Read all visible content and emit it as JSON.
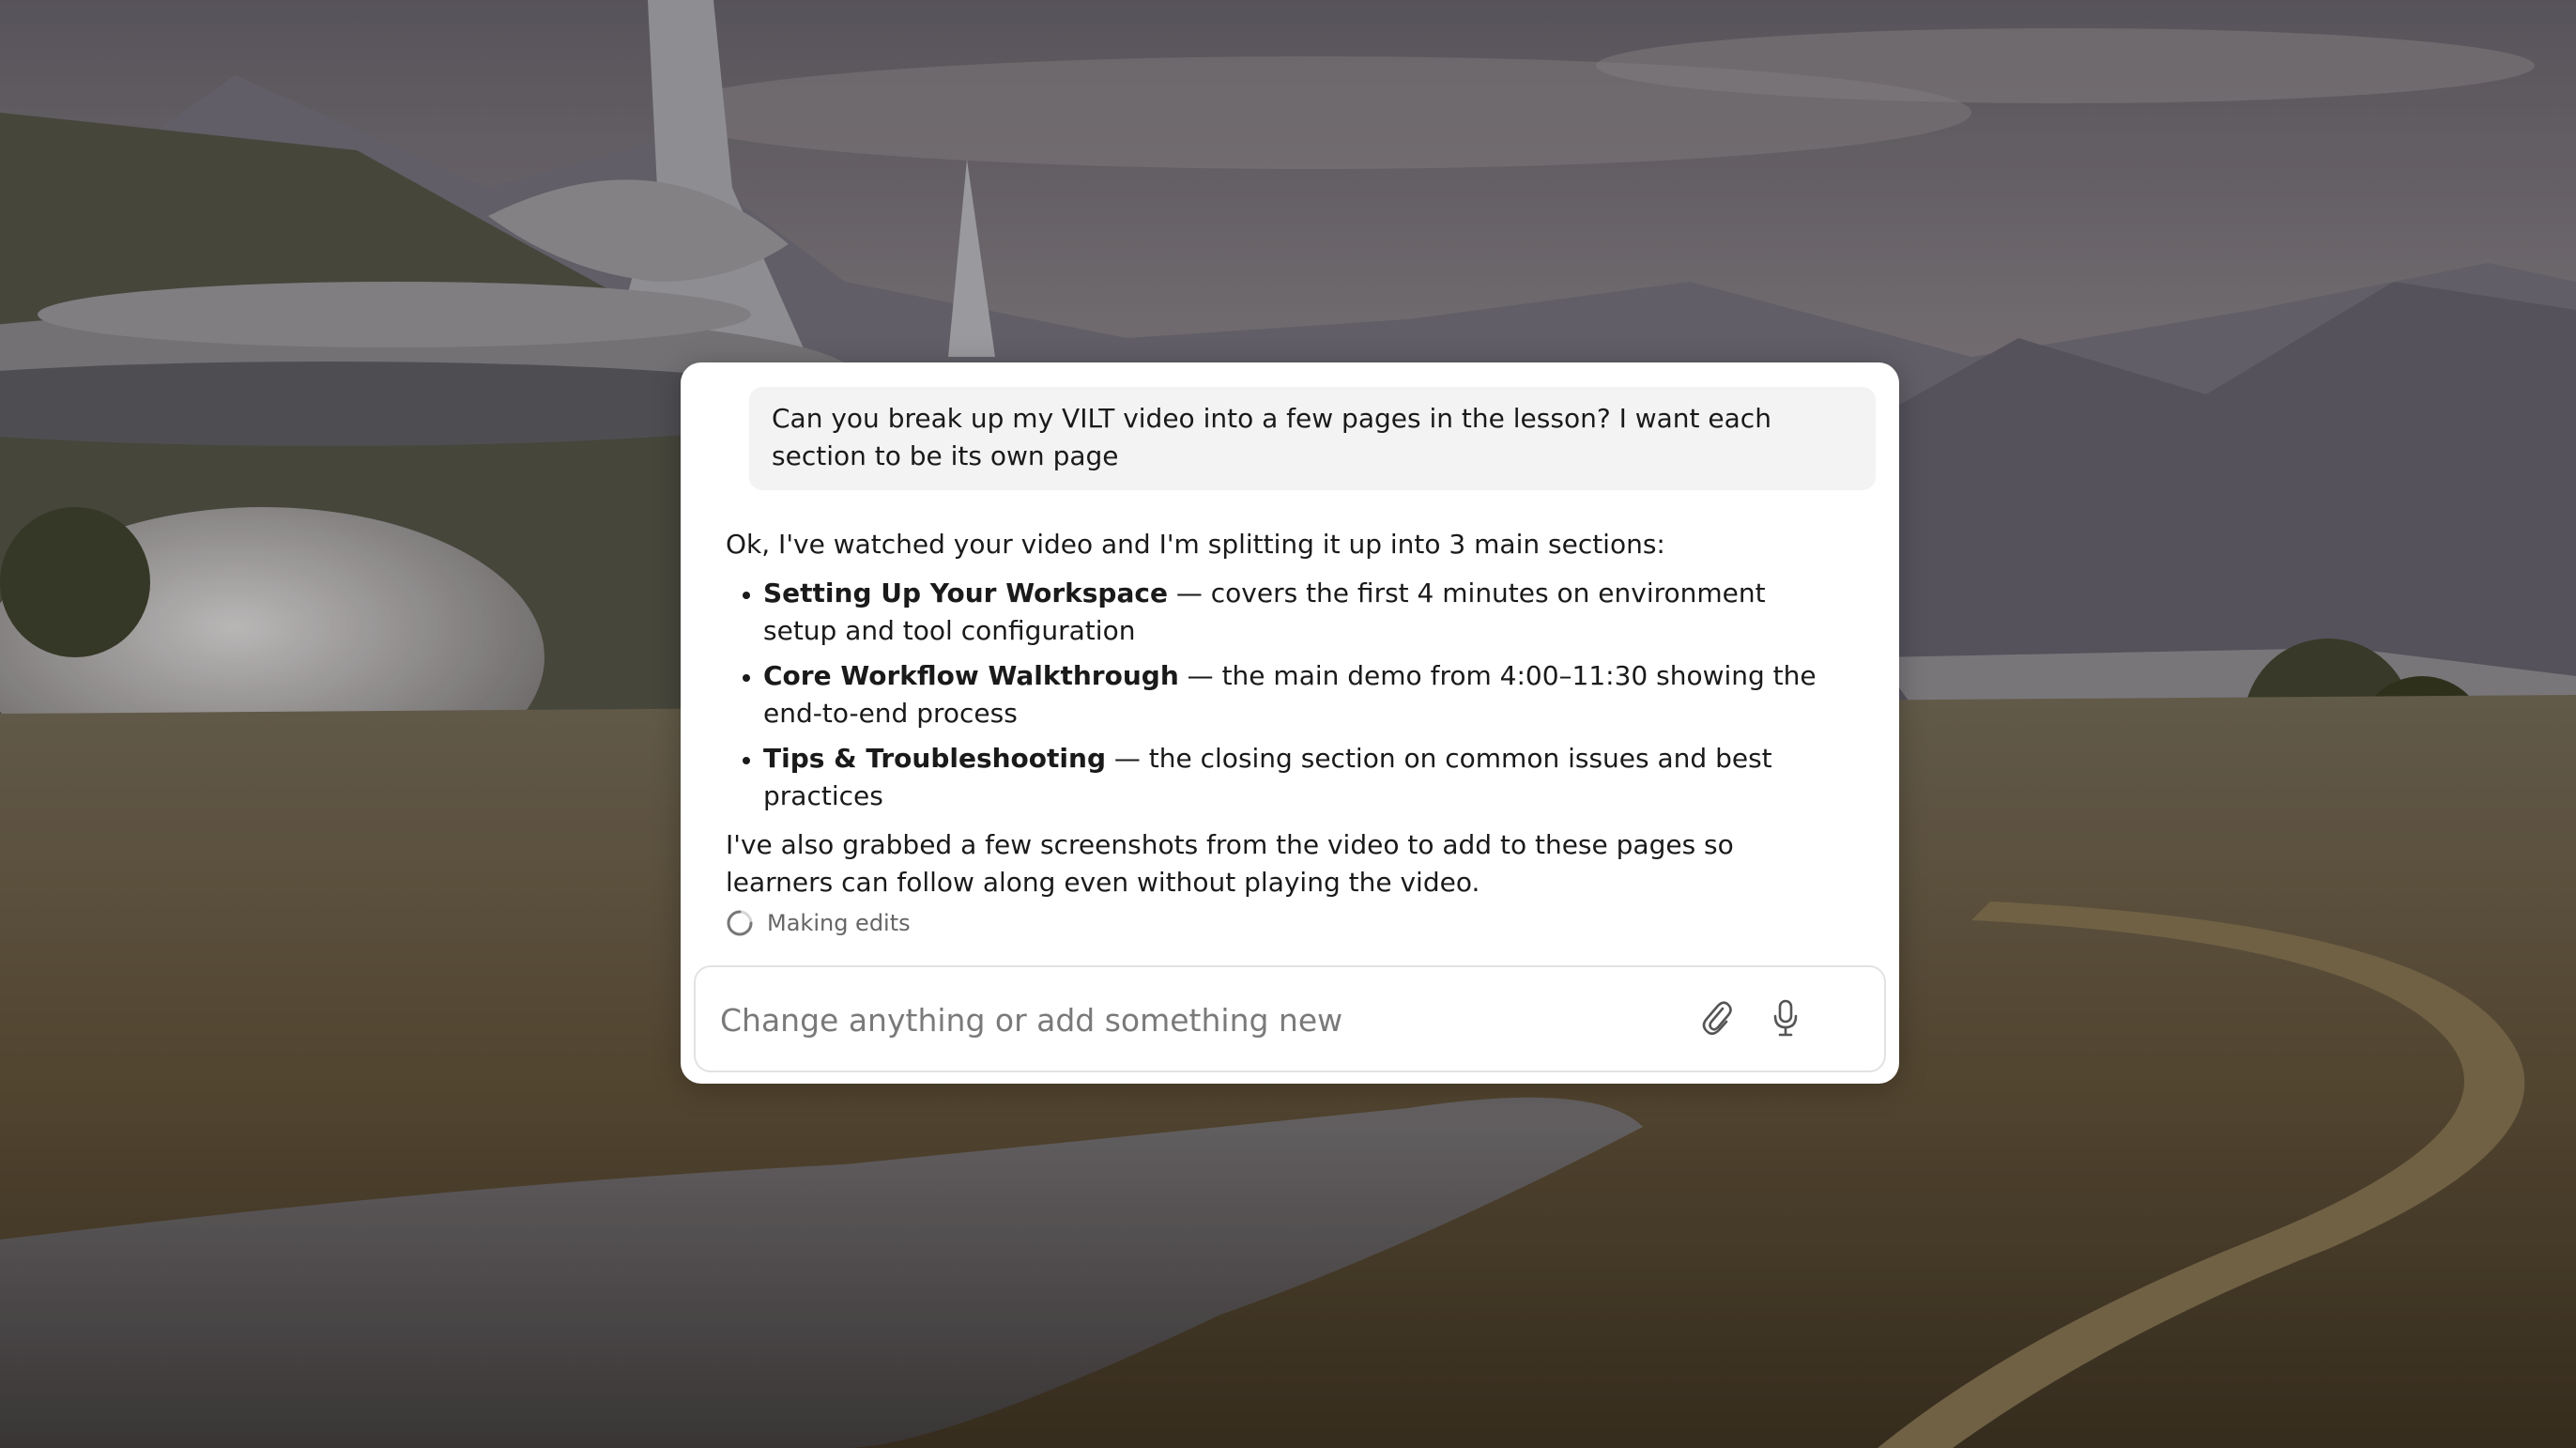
{
  "chat": {
    "user_message": "Can you break up my VILT video into a few pages in the lesson? I want each section to be its own page",
    "assistant": {
      "intro": "Ok, I've watched your video and I'm splitting it up into 3 main sections:",
      "sections": [
        {
          "title": "Setting Up Your Workspace",
          "description": " — covers the first 4 minutes on environment setup and tool configuration"
        },
        {
          "title": "Core Workflow Walkthrough",
          "description": " — the main demo from 4:00–11:30 showing the end-to-end process"
        },
        {
          "title": "Tips & Troubleshooting",
          "description": " — the closing section on common issues and best practices"
        }
      ],
      "outro": "I've also grabbed a few screenshots from the video to add to these pages so learners can follow along even without playing the video."
    },
    "status": {
      "icon": "spinner-icon",
      "label": "Making edits"
    }
  },
  "composer": {
    "placeholder": "Change anything or add something new",
    "value": "",
    "attach_icon": "paperclip-icon",
    "mic_icon": "microphone-icon"
  },
  "colors": {
    "panel_bg": "#ffffff",
    "user_bubble_bg": "#f3f3f3",
    "text": "#1a1a1a",
    "muted": "#666666"
  }
}
